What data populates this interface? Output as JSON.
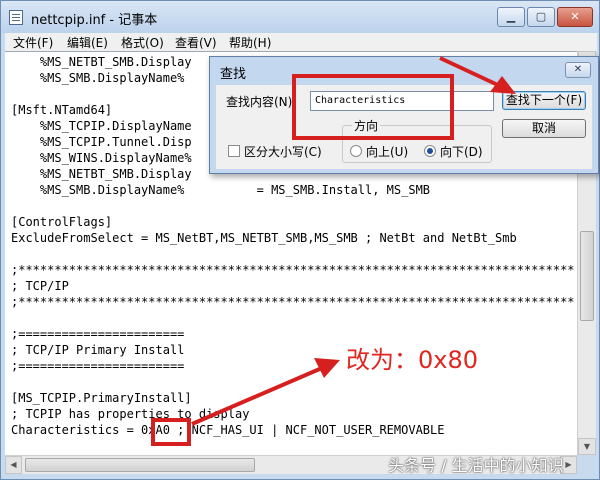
{
  "window": {
    "title": "nettcpip.inf - 记事本",
    "min_label": "▁",
    "max_label": "▢",
    "close_label": "✕"
  },
  "menu": [
    "文件(F)",
    "编辑(E)",
    "格式(O)",
    "查看(V)",
    "帮助(H)"
  ],
  "editor_lines": [
    "    %MS_NETBT_SMB.Display",
    "    %MS_SMB.DisplayName%",
    "",
    "[Msft.NTamd64]",
    "    %MS_TCPIP.DisplayName",
    "    %MS_TCPIP.Tunnel.Disp",
    "    %MS_WINS.DisplayName%",
    "    %MS_NETBT_SMB.Display",
    "    %MS_SMB.DisplayName%          = MS_SMB.Install, MS_SMB",
    "",
    "[ControlFlags]",
    "ExcludeFromSelect = MS_NetBT,MS_NETBT_SMB,MS_SMB ; NetBt and NetBt_Smb",
    "",
    ";*****************************************************************************",
    "; TCP/IP",
    ";*****************************************************************************",
    "",
    ";=======================",
    "; TCP/IP Primary Install",
    ";=======================",
    "",
    "[MS_TCPIP.PrimaryInstall]",
    "; TCPIP has properties to display",
    "Characteristics = 0xA0 ; NCF_HAS_UI | NCF_NOT_USER_REMOVABLE"
  ],
  "find_dialog": {
    "title": "查找",
    "close_label": "✕",
    "find_label": "查找内容(N):",
    "find_value": "Characteristics",
    "find_next_button": "查找下一个(F)",
    "cancel_button": "取消",
    "match_case_label": "区分大小写(C)",
    "direction_label": "方向",
    "up_label": "向上(U)",
    "down_label": "向下(D)",
    "direction_selected": "down"
  },
  "annotation": {
    "text": "改为：0x80",
    "color": "#e0261f"
  },
  "watermark": "头条号 / 生活中的小知识"
}
